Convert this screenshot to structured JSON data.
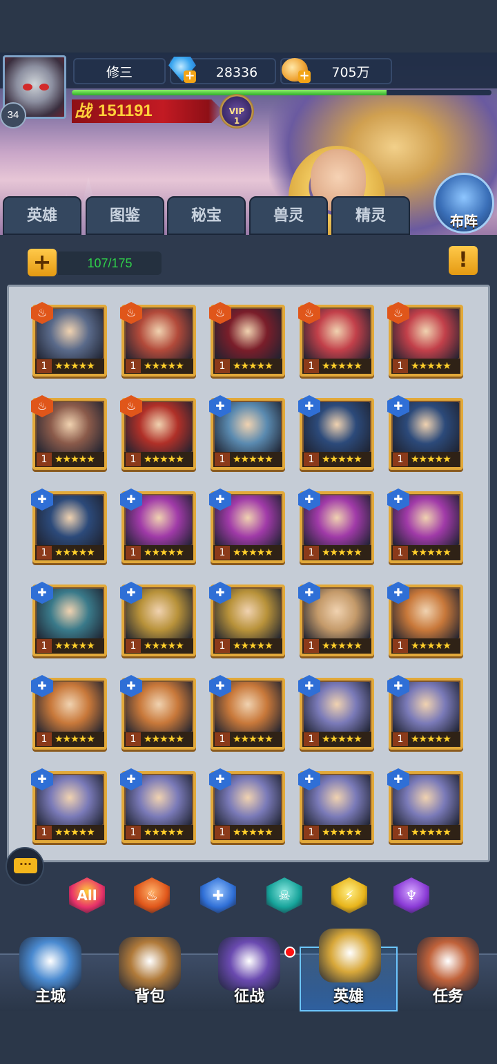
{
  "header": {
    "player_name": "修三",
    "level": "34",
    "gems": "28336",
    "gold": "705万",
    "exp_fraction": 0.75,
    "power_label": "战",
    "power_value": "151191",
    "vip_label": "VIP",
    "vip_level": "1"
  },
  "tabs": [
    {
      "label": "英雄",
      "active": true
    },
    {
      "label": "图鉴",
      "active": false
    },
    {
      "label": "秘宝",
      "active": false
    },
    {
      "label": "兽灵",
      "active": false
    },
    {
      "label": "精灵",
      "active": false
    }
  ],
  "formation_label": "布阵",
  "inventory": {
    "add_label": "+",
    "count": "107/175",
    "warn_label": "!"
  },
  "heroes": [
    {
      "faction": "fire",
      "level": "1",
      "stars": 5,
      "portrait": "grey-brute",
      "color": "#5a6a8a"
    },
    {
      "faction": "fire",
      "level": "1",
      "stars": 5,
      "portrait": "red-masked-woman",
      "color": "#b24a3a"
    },
    {
      "faction": "fire",
      "level": "1",
      "stars": 5,
      "portrait": "horned-demon",
      "color": "#7a1e2a"
    },
    {
      "faction": "fire",
      "level": "1",
      "stars": 5,
      "portrait": "red-demon",
      "color": "#c2404a"
    },
    {
      "faction": "fire",
      "level": "1",
      "stars": 5,
      "portrait": "red-demon",
      "color": "#c2404a"
    },
    {
      "faction": "fire",
      "level": "1",
      "stars": 5,
      "portrait": "scarred-warrior",
      "color": "#8a5a4a"
    },
    {
      "faction": "fire",
      "level": "1",
      "stars": 5,
      "portrait": "red-ogre",
      "color": "#b03028"
    },
    {
      "faction": "holy",
      "level": "1",
      "stars": 5,
      "portrait": "goggle-girl",
      "color": "#5a8ab0"
    },
    {
      "faction": "holy",
      "level": "1",
      "stars": 5,
      "portrait": "armored-knight",
      "color": "#2c4a7a"
    },
    {
      "faction": "holy",
      "level": "1",
      "stars": 5,
      "portrait": "armored-knight",
      "color": "#2c4a7a"
    },
    {
      "faction": "holy",
      "level": "1",
      "stars": 5,
      "portrait": "armored-knight",
      "color": "#2c4a7a"
    },
    {
      "faction": "holy",
      "level": "1",
      "stars": 5,
      "portrait": "purple-witch",
      "color": "#a03aa8"
    },
    {
      "faction": "holy",
      "level": "1",
      "stars": 5,
      "portrait": "purple-witch",
      "color": "#a03aa8"
    },
    {
      "faction": "holy",
      "level": "1",
      "stars": 5,
      "portrait": "purple-witch",
      "color": "#a03aa8"
    },
    {
      "faction": "holy",
      "level": "1",
      "stars": 5,
      "portrait": "purple-witch",
      "color": "#a03aa8"
    },
    {
      "faction": "holy",
      "level": "1",
      "stars": 5,
      "portrait": "teal-hair-mage",
      "color": "#3a7a8a"
    },
    {
      "faction": "holy",
      "level": "1",
      "stars": 5,
      "portrait": "golden-helm",
      "color": "#b8923a"
    },
    {
      "faction": "holy",
      "level": "1",
      "stars": 5,
      "portrait": "golden-helm",
      "color": "#b8923a"
    },
    {
      "faction": "holy",
      "level": "1",
      "stars": 5,
      "portrait": "old-dwarf",
      "color": "#c49a6a"
    },
    {
      "faction": "holy",
      "level": "1",
      "stars": 5,
      "portrait": "eyepatch-captain",
      "color": "#c8783a"
    },
    {
      "faction": "holy",
      "level": "1",
      "stars": 5,
      "portrait": "eyepatch-captain",
      "color": "#c8783a"
    },
    {
      "faction": "holy",
      "level": "1",
      "stars": 5,
      "portrait": "eyepatch-captain",
      "color": "#c8783a"
    },
    {
      "faction": "holy",
      "level": "1",
      "stars": 5,
      "portrait": "eyepatch-captain",
      "color": "#c8783a"
    },
    {
      "faction": "holy",
      "level": "1",
      "stars": 5,
      "portrait": "white-hair-sorceress",
      "color": "#7a7ab8"
    },
    {
      "faction": "holy",
      "level": "1",
      "stars": 5,
      "portrait": "white-hair-sorceress",
      "color": "#7a7ab8"
    },
    {
      "faction": "holy",
      "level": "1",
      "stars": 5,
      "portrait": "white-hair-sorceress",
      "color": "#7a7ab8"
    },
    {
      "faction": "holy",
      "level": "1",
      "stars": 5,
      "portrait": "white-hair-sorceress",
      "color": "#7a7ab8"
    },
    {
      "faction": "holy",
      "level": "1",
      "stars": 5,
      "portrait": "white-hair-sorceress",
      "color": "#7a7ab8"
    },
    {
      "faction": "holy",
      "level": "1",
      "stars": 5,
      "portrait": "white-hair-sorceress",
      "color": "#7a7ab8"
    },
    {
      "faction": "holy",
      "level": "1",
      "stars": 5,
      "portrait": "white-hair-sorceress",
      "color": "#7a7ab8"
    }
  ],
  "filters": [
    {
      "name": "all",
      "label": "All",
      "color": "#e8326a",
      "border": "#ffd13a",
      "active": true
    },
    {
      "name": "fire",
      "label": "",
      "color": "#e0561a",
      "border": "#ffb26a",
      "active": false
    },
    {
      "name": "holy",
      "label": "",
      "color": "#2f6fd6",
      "border": "#9ac6ff",
      "active": false
    },
    {
      "name": "undead",
      "label": "",
      "color": "#16a39a",
      "border": "#8ae6de",
      "active": false
    },
    {
      "name": "nature",
      "label": "",
      "color": "#e8b41a",
      "border": "#fff08a",
      "active": false
    },
    {
      "name": "shadow",
      "label": "",
      "color": "#8a3ad6",
      "border": "#d4a6ff",
      "active": false
    }
  ],
  "bottom_nav": [
    {
      "label": "主城",
      "icon": "castle-icon",
      "color": "#4a8ad0",
      "active": false
    },
    {
      "label": "背包",
      "icon": "chest-icon",
      "color": "#b07a3a",
      "active": false
    },
    {
      "label": "征战",
      "icon": "dragon-portal-icon",
      "color": "#6a4ab0",
      "active": false,
      "badge": true
    },
    {
      "label": "英雄",
      "icon": "hero-helmet-icon",
      "color": "#d8a83a",
      "active": true
    },
    {
      "label": "任务",
      "icon": "scroll-icon",
      "color": "#c0623a",
      "active": false
    }
  ],
  "chat_label": "···"
}
